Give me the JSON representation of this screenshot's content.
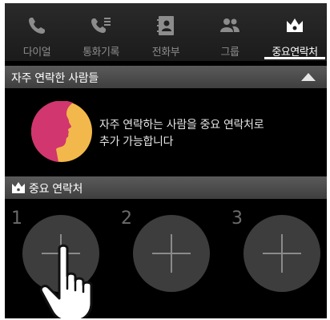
{
  "tabs": [
    {
      "label": "다이얼",
      "icon": "phone-icon"
    },
    {
      "label": "통화기록",
      "icon": "call-log-icon"
    },
    {
      "label": "전화부",
      "icon": "contacts-book-icon"
    },
    {
      "label": "그룹",
      "icon": "group-icon"
    },
    {
      "label": "중요연락처",
      "icon": "crown-icon"
    }
  ],
  "active_tab": "중요연락처",
  "frequent": {
    "title": "자주 연락한 사람들",
    "info_line1": "자주 연락하는 사람을 중요 연락처로",
    "info_line2": "추가 가능합니다"
  },
  "important": {
    "title": "중요 연락처",
    "slots": [
      {
        "number": "1"
      },
      {
        "number": "2"
      },
      {
        "number": "3"
      }
    ]
  },
  "colors": {
    "avatar_bg": "#f2b84b",
    "avatar_face": "#d1366e",
    "slot_bg": "#3d3d3d"
  }
}
